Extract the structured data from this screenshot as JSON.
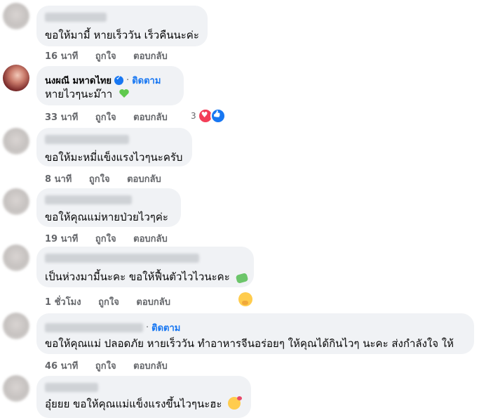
{
  "comments": [
    {
      "author": "",
      "text": "ขอให้มามี้ หายเร็ววัน เร็วคืนนะค่ะ",
      "time": "16 นาที",
      "like_label": "ถูกใจ",
      "reply_label": "ตอบกลับ"
    },
    {
      "author": "นงผณี มหาดไทย",
      "verified": true,
      "separator": "·",
      "follow_label": "ติดตาม",
      "text": "หายไวๆนะม๊าา",
      "emoji": "green-heart",
      "time": "33 นาที",
      "like_label": "ถูกใจ",
      "reply_label": "ตอบกลับ",
      "reaction_count": "3",
      "reactions": [
        "love",
        "like"
      ]
    },
    {
      "author": "",
      "text": "ขอให้มะหมี่แข็งแรงไวๆนะครับ",
      "time": "8 นาที",
      "like_label": "ถูกใจ",
      "reply_label": "ตอบกลับ"
    },
    {
      "author": "",
      "text": "ขอให้คุณแม่หายป่วยไวๆค่ะ",
      "time": "19 นาที",
      "like_label": "ถูกใจ",
      "reply_label": "ตอบกลับ"
    },
    {
      "author": "",
      "text": "เป็นห่วงมามี้นะคะ ขอให้ฟื้นตัวไวไวนะคะ",
      "emoji": "money-with-wings",
      "time": "1 ชั่วโมง",
      "like_label": "ถูกใจ",
      "reply_label": "ตอบกลับ",
      "reactions": [
        "care"
      ]
    },
    {
      "author": "",
      "separator": "·",
      "follow_label": "ติดตาม",
      "text": "ขอให้คุณแม่ ปลอดภัย หายเร็ววัน ทำอาหารจีนอร่อยๆ ให้คุณได้กินไวๆ นะคะ ส่งกำลังใจ ให้",
      "time": "46 นาที",
      "like_label": "ถูกใจ",
      "reply_label": "ตอบกลับ"
    },
    {
      "author": "",
      "text": "อุ๋ยยย ขอให้คุณแม่แข็งแรงขึ้นไวๆนะฮะ",
      "emoji": "smiling-face-with-hearts"
    }
  ],
  "colors": {
    "bubble": "#f0f2f5",
    "link": "#1877f2",
    "meta": "#65676b"
  }
}
